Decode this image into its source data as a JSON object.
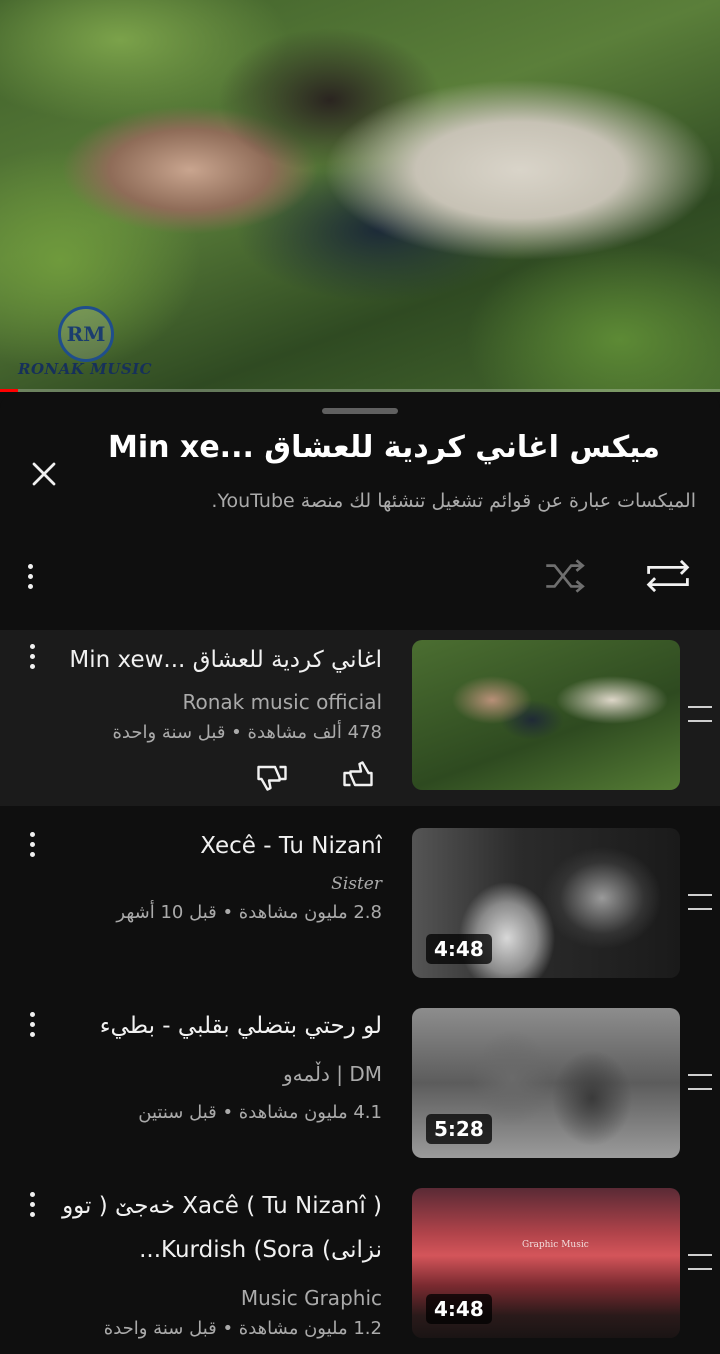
{
  "player": {
    "watermark_text": "RONAK MUSIC",
    "watermark_logo": "RM",
    "progress_fraction": 0.025
  },
  "panel": {
    "title": "ميكس اغاني كردية للعشاق ...Min xe",
    "subtitle": "الميكسات عبارة عن قوائم تشغيل تنشئها لك منصة YouTube.",
    "icons": {
      "close": "close-icon",
      "more": "more-vertical-icon",
      "shuffle": "shuffle-icon",
      "repeat": "repeat-icon"
    }
  },
  "items": [
    {
      "title": "اغاني كردية للعشاق ...Min xew",
      "channel": "Ronak music official",
      "meta": "478 ألف مشاهدة • قبل سنة واحدة",
      "duration": "",
      "active": true
    },
    {
      "title": "Xecê - Tu Nizanî",
      "channel": "Sister",
      "meta": "2.8 مليون مشاهدة • قبل 10 أشهر",
      "duration": "4:48",
      "active": false
    },
    {
      "title": "لو رحتي بتضلي بقلبي - بطيء",
      "channel": "DM | دڵمەو",
      "meta": "4.1 مليون مشاهدة • قبل سنتين",
      "duration": "5:28",
      "active": false
    },
    {
      "title": "Xacê ( Tu Nizanî ) خەجێ ( توو نزانی) Kurdish (Sora...",
      "channel": "Music Graphic",
      "meta": "1.2 مليون مشاهدة • قبل سنة واحدة",
      "duration": "4:48",
      "active": false,
      "thumb_text": "Graphic Music"
    }
  ]
}
